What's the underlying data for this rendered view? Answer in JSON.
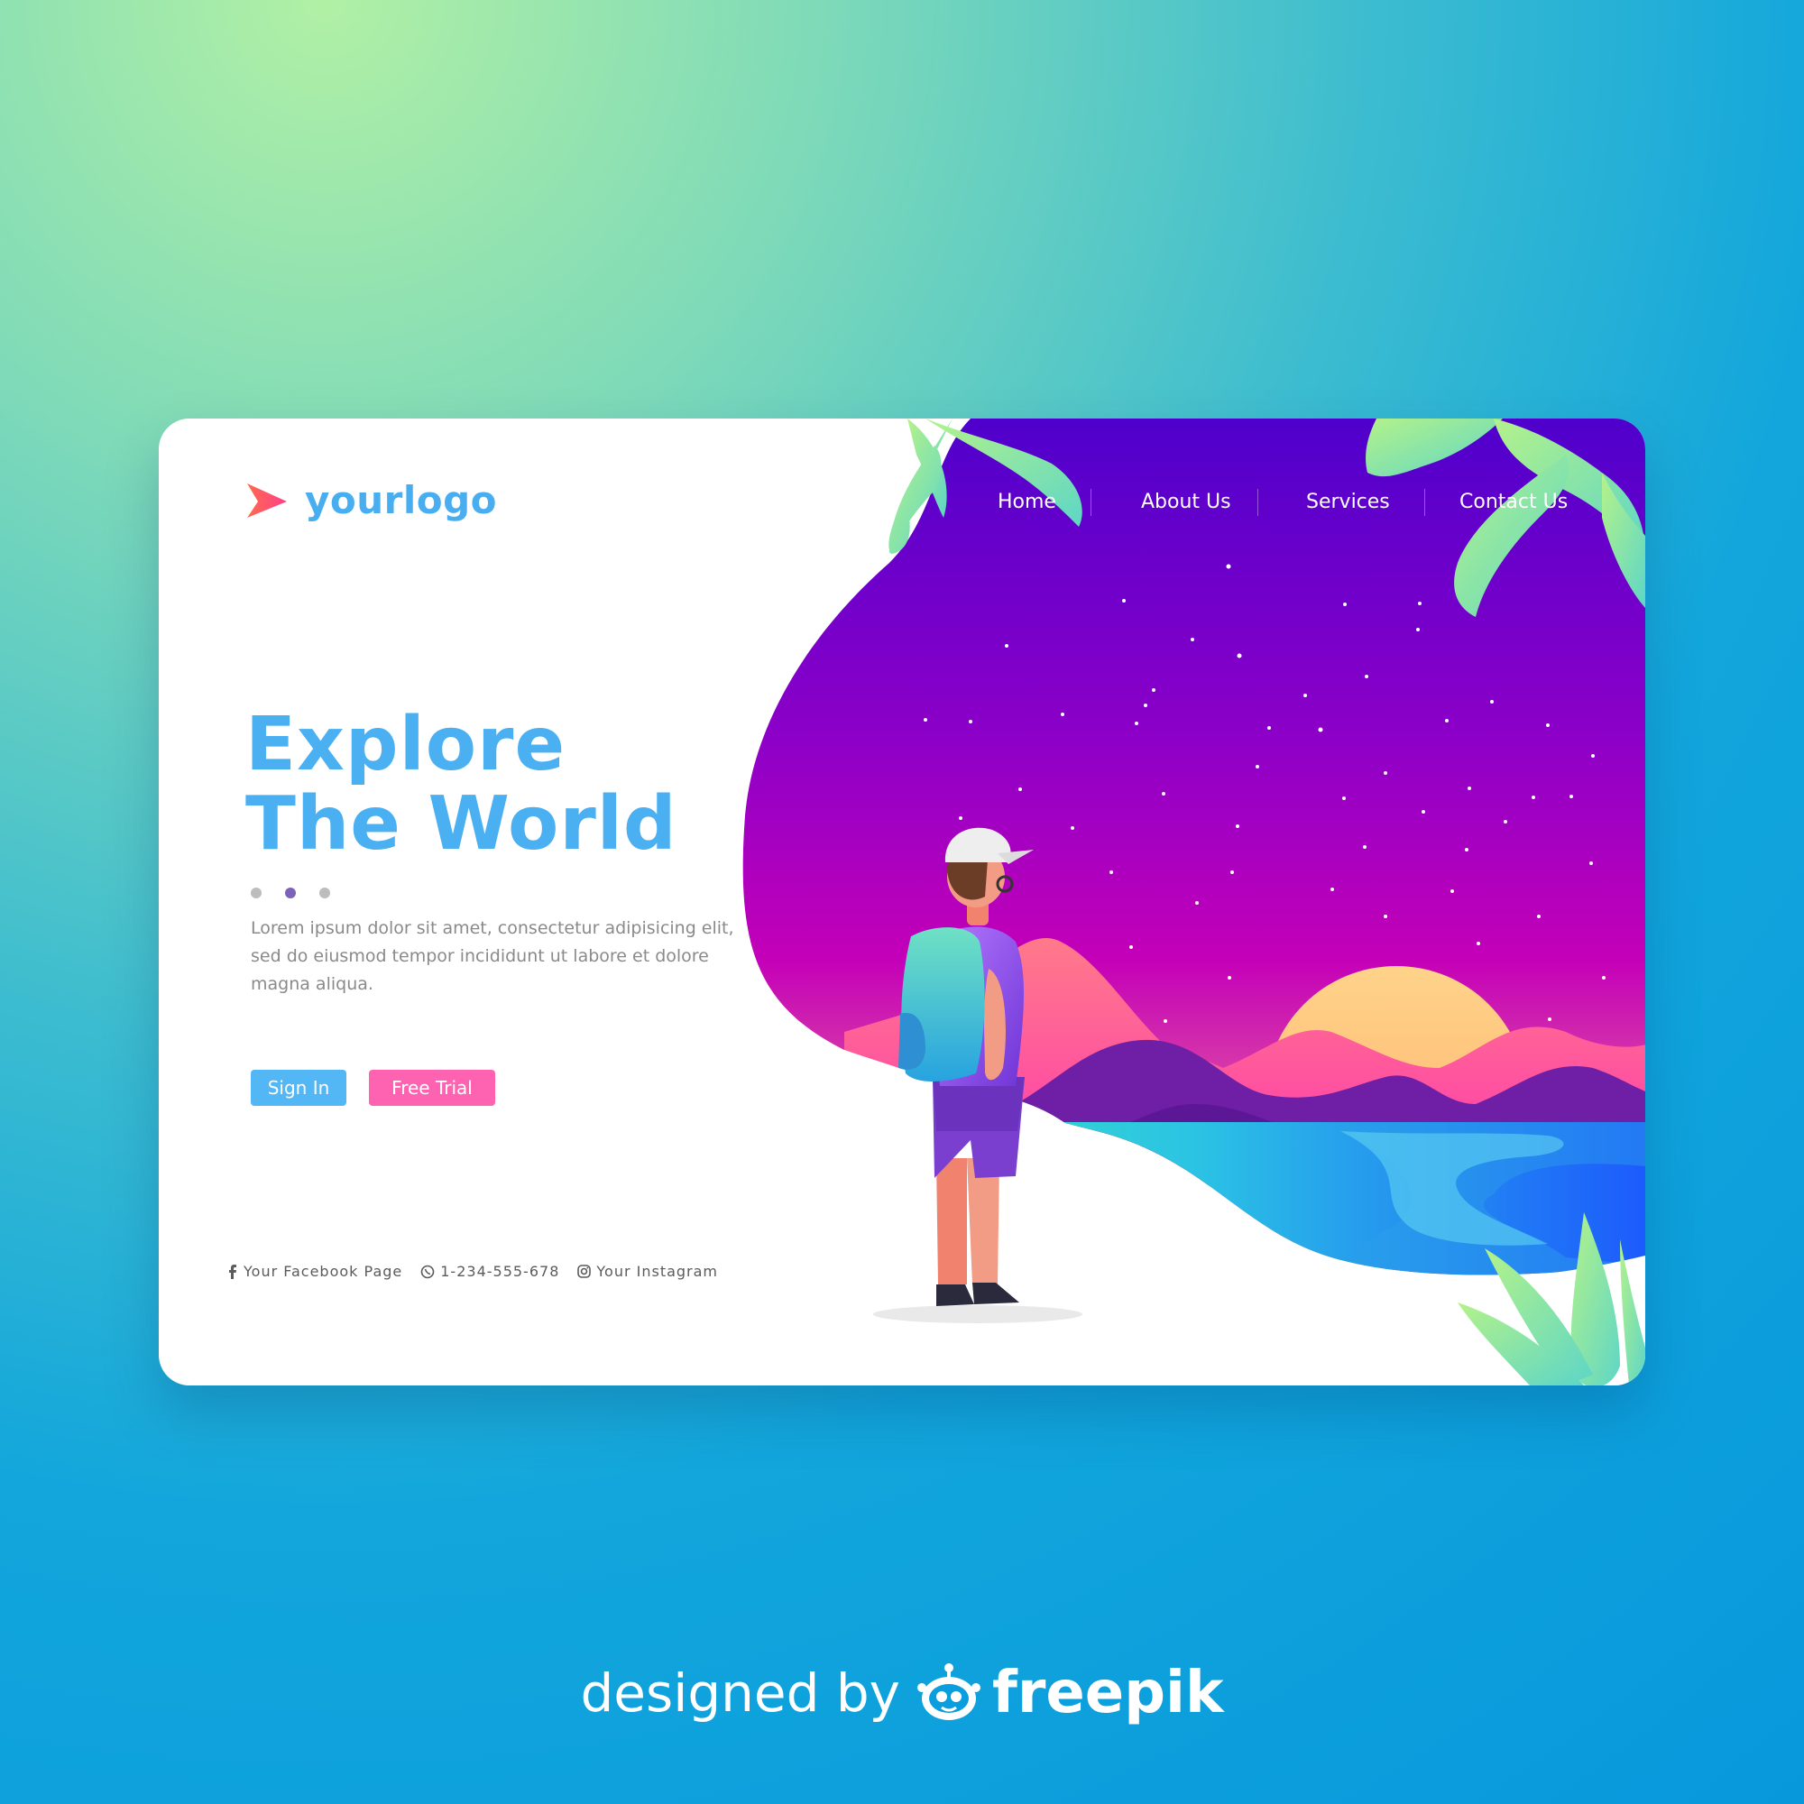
{
  "colors": {
    "accent_blue": "#4ab0f2",
    "accent_pink": "#fd63b0",
    "active_dot": "#7d62b8",
    "sky_top": "#5a00cf",
    "sky_bottom": "#ff4fb3",
    "sun": "#ffc77c"
  },
  "logo": {
    "text": "yourlogo",
    "icon": "arrow-logo-icon"
  },
  "nav": {
    "items": [
      "Home",
      "About Us",
      "Services",
      "Contact Us"
    ]
  },
  "hero": {
    "title_line1": "Explore",
    "title_line2": "The World",
    "description": "Lorem ipsum dolor sit amet, consectetur adipisicing elit, sed do eiusmod tempor incididunt ut labore et dolore magna aliqua.",
    "slider": {
      "count": 3,
      "active_index": 1
    }
  },
  "buttons": {
    "sign_in": "Sign In",
    "free_trial": "Free Trial"
  },
  "footer": {
    "facebook": "Your Facebook Page",
    "phone": "1-234-555-678",
    "instagram": "Your Instagram",
    "icons": [
      "facebook-icon",
      "whatsapp-icon",
      "instagram-icon"
    ]
  },
  "credit": {
    "text": "designed by",
    "brand": "freepik"
  }
}
